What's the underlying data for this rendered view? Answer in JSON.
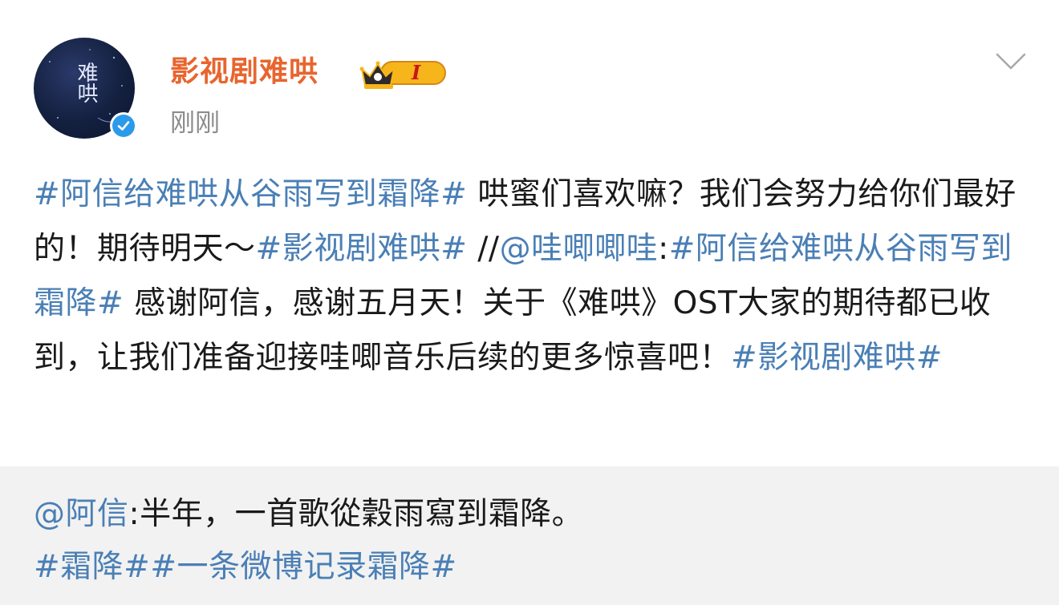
{
  "post": {
    "author": {
      "name": "影视剧难哄",
      "badge_level": "I",
      "avatar_text": "难哄",
      "verified": true
    },
    "timestamp": "刚刚",
    "content": {
      "tag1": "#阿信给难哄从谷雨写到霜降#",
      "text1": " 哄蜜们喜欢嘛？我们会努力给你们最好的！期待明天～",
      "tag2": "#影视剧难哄#",
      "repost_sep": " //",
      "mention": "@哇唧唧哇",
      "colon": ":",
      "tag3": "#阿信给难哄从谷雨写到霜降#",
      "text2": " 感谢阿信，感谢五月天！关于《难哄》OST大家的期待都已收到，让我们准备迎接哇唧音乐后续的更多惊喜吧！",
      "tag4": "#影视剧难哄#"
    }
  },
  "repost": {
    "mention": "@阿信",
    "text": ":半年，一首歌從穀雨寫到霜降。",
    "tag1": "#霜降#",
    "tag2": "#一条微博记录霜降#"
  },
  "colors": {
    "username": "#e8652e",
    "link": "#4a7fb5",
    "timestamp": "#8b8b8b",
    "verified": "#2c9aeb",
    "repost_bg": "#f2f2f2"
  },
  "icons": {
    "more": "chevron-down-icon",
    "verified": "verified-icon",
    "badge": "crown-badge-icon"
  }
}
